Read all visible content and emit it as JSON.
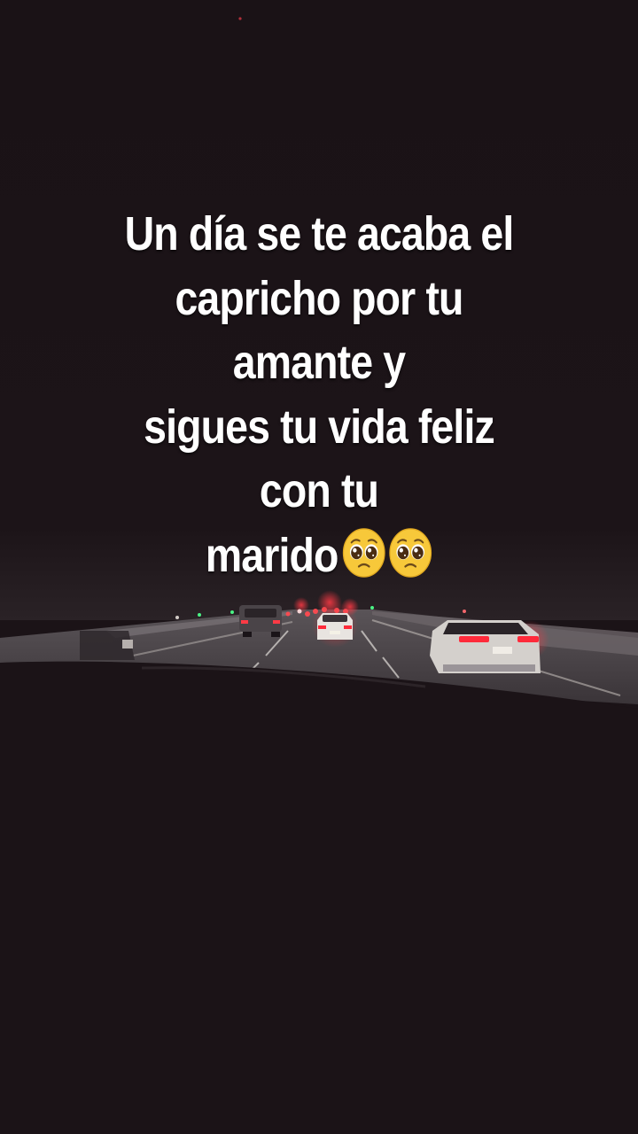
{
  "caption": {
    "lines": [
      "Un día se te acaba el",
      "capricho por tu",
      "amante y",
      "sigues tu vida feliz",
      "con tu",
      "marido"
    ],
    "trailing_icons": [
      "pleading-face-emoji",
      "pleading-face-emoji"
    ]
  },
  "colors": {
    "background": "#1b1317",
    "text": "#ffffff",
    "taillight": "#ff2a3a",
    "headlight": "#f4f1e6",
    "green_light": "#4cff8a"
  }
}
